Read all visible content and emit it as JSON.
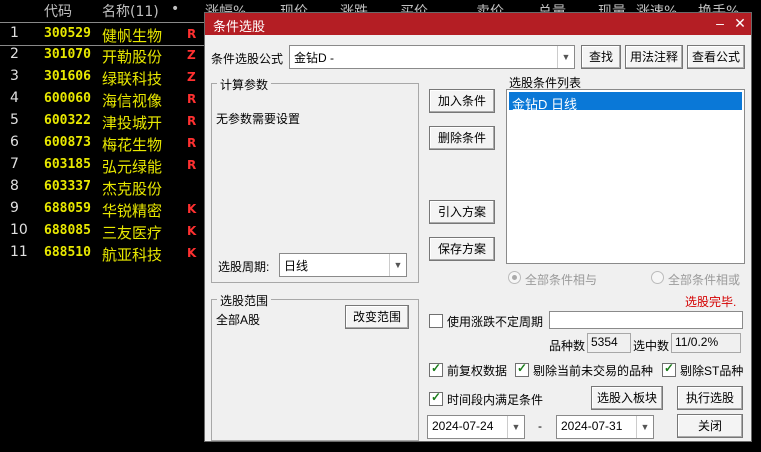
{
  "header": {
    "code": "代码",
    "name": "名称(11)",
    "dot": "•",
    "pct": "涨幅%",
    "price": "现价",
    "change": "涨跌",
    "bid": "买价",
    "ask": "卖价",
    "volume": "总量",
    "curvol": "现量",
    "speed": "涨速%",
    "turnover": "换手%"
  },
  "stocks": [
    {
      "idx": "1",
      "code": "300529",
      "name": "健帆生物",
      "flag": "R",
      "flag_color": "#ff3030"
    },
    {
      "idx": "2",
      "code": "301070",
      "name": "开勒股份",
      "flag": "Z",
      "flag_color": "#ff3030"
    },
    {
      "idx": "3",
      "code": "301606",
      "name": "绿联科技",
      "flag": "Z",
      "flag_color": "#ff3030"
    },
    {
      "idx": "4",
      "code": "600060",
      "name": "海信视像",
      "flag": "R",
      "flag_color": "#ff3030"
    },
    {
      "idx": "5",
      "code": "600322",
      "name": "津投城开",
      "flag": "R",
      "flag_color": "#ff3030"
    },
    {
      "idx": "6",
      "code": "600873",
      "name": "梅花生物",
      "flag": "R",
      "flag_color": "#ff3030"
    },
    {
      "idx": "7",
      "code": "603185",
      "name": "弘元绿能",
      "flag": "R",
      "flag_color": "#ff3030"
    },
    {
      "idx": "8",
      "code": "603337",
      "name": "杰克股份",
      "flag": "",
      "flag_color": "#ff3030"
    },
    {
      "idx": "9",
      "code": "688059",
      "name": "华锐精密",
      "flag": "K",
      "flag_color": "#ff3030"
    },
    {
      "idx": "10",
      "code": "688085",
      "name": "三友医疗",
      "flag": "K",
      "flag_color": "#ff3030"
    },
    {
      "idx": "11",
      "code": "688510",
      "name": "航亚科技",
      "flag": "K",
      "flag_color": "#ff3030"
    }
  ],
  "dialog": {
    "title": "条件选股",
    "formula_label": "条件选股公式",
    "formula_value": "金钻D        -",
    "find": "查找",
    "usage": "用法注释",
    "view_formula": "查看公式",
    "params_group": "计算参数",
    "no_params": "无参数需要设置",
    "period_label": "选股周期:",
    "period_value": "日线",
    "add_condition": "加入条件",
    "delete_condition": "删除条件",
    "import_plan": "引入方案",
    "save_plan": "保存方案",
    "list_label": "选股条件列表",
    "list_items": [
      "金钻D  日线"
    ],
    "all_and": "全部条件相与",
    "all_or": "全部条件相或",
    "status": "选股完毕.",
    "range_group": "选股范围",
    "range_value": "全部A股",
    "change_range": "改变范围",
    "use_period": "使用涨跌不定周期",
    "pinzhong_label": "品种数",
    "pinzhong_value": "5354",
    "selected_label": "选中数",
    "selected_value": "11/0.2%",
    "fq": "前复权数据",
    "exclude_untraded": "剔除当前未交易的品种",
    "exclude_st": "剔除ST品种",
    "time_range": "时间段内满足条件",
    "to_board": "选股入板块",
    "execute": "执行选股",
    "date_from": "2024-07-24",
    "date_sep": "-",
    "date_to": "2024-07-31",
    "close": "关闭"
  },
  "colors": {
    "title_bar": "#b41e24",
    "list_selection": "#0a78d7",
    "status": "#d40000",
    "stock_text": "#e8e800"
  }
}
